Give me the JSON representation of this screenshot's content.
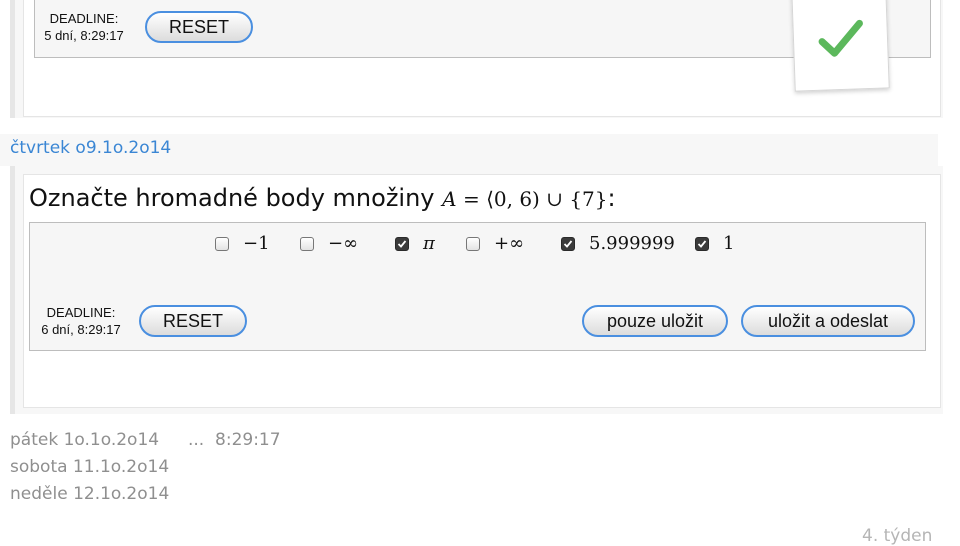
{
  "previous_task": {
    "deadline_label": "DEADLINE:",
    "deadline_value": "5 dní, 8:29:17",
    "reset_label": "RESET",
    "status_icon": "checkmark-icon",
    "status_color": "#5cb85c"
  },
  "current_day": {
    "heading": "čtvrtek o9.1o.2o14",
    "task": {
      "question_text": "Označte hromadné body množiny",
      "math_lhs": "A",
      "math_eq": " = ",
      "math_set": "⟨0, 6) ∪ {7}",
      "question_suffix": ":",
      "options": [
        {
          "label": "−1",
          "checked": false
        },
        {
          "label": "−∞",
          "checked": false
        },
        {
          "label": "π",
          "checked": true
        },
        {
          "label": "+∞",
          "checked": false
        },
        {
          "label": "5.999999",
          "checked": true
        },
        {
          "label": "1",
          "checked": true
        }
      ],
      "deadline_label": "DEADLINE:",
      "deadline_value": "6 dní, 8:29:17",
      "reset_label": "RESET",
      "save_label": "pouze uložit",
      "submit_label": "uložit a odeslat"
    }
  },
  "upcoming_days": [
    {
      "heading": "pátek 1o.1o.2o14",
      "countdown": "...  8:29:17"
    },
    {
      "heading": "sobota 11.1o.2o14"
    },
    {
      "heading": "neděle 12.1o.2o14"
    }
  ],
  "week_label": "4. týden",
  "colors": {
    "accent": "#3a86d4",
    "button_border": "#4a8fe0",
    "muted_text": "#8f8f8f"
  }
}
